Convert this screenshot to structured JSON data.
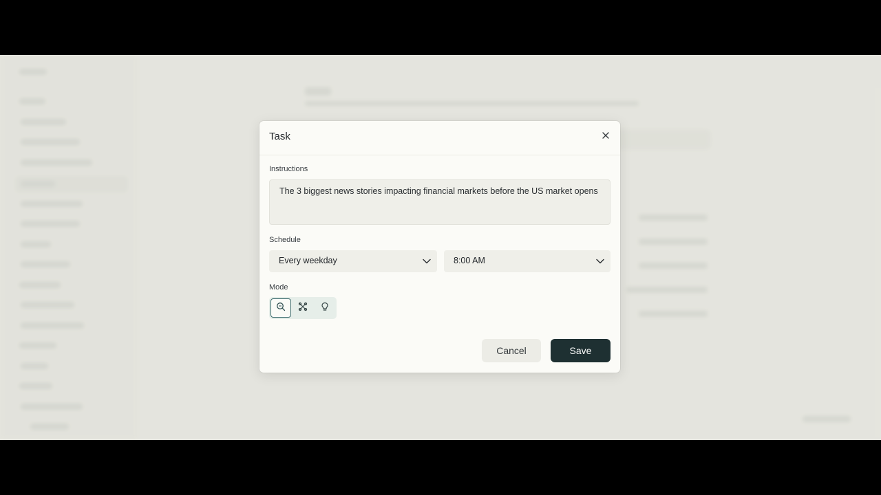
{
  "modal": {
    "title": "Task",
    "close_icon": "close-icon",
    "instructions": {
      "label": "Instructions",
      "value": "The 3 biggest news stories impacting financial markets before the US market opens"
    },
    "schedule": {
      "label": "Schedule",
      "frequency": "Every weekday",
      "time": "8:00 AM"
    },
    "mode": {
      "label": "Mode",
      "options": [
        {
          "icon": "search-icon",
          "selected": true
        },
        {
          "icon": "network-icon",
          "selected": false
        },
        {
          "icon": "lightbulb-icon",
          "selected": false
        }
      ]
    },
    "buttons": {
      "cancel": "Cancel",
      "save": "Save"
    }
  },
  "colors": {
    "primary_button": "#1e3032",
    "active_mode_border": "#3c6b6c",
    "modal_background": "#fbfbf7",
    "field_background": "#efefe9"
  }
}
